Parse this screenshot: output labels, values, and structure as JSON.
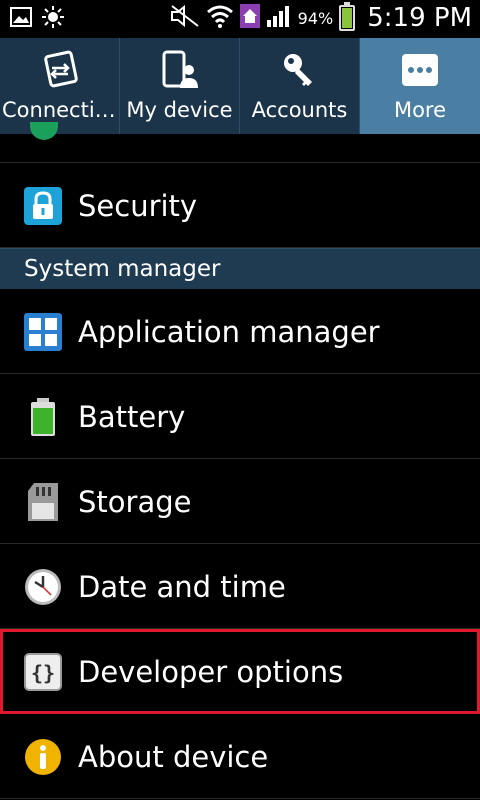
{
  "status_bar": {
    "battery_percent": "94%",
    "time": "5:19 PM",
    "icons": [
      "image-icon",
      "brightness-icon",
      "mute-icon",
      "wifi-icon",
      "home-icon",
      "signal-icon",
      "battery-icon"
    ]
  },
  "tabs": [
    {
      "label": "Connectio..",
      "icon": "connections-icon",
      "active": false
    },
    {
      "label": "My device",
      "icon": "my-device-icon",
      "active": false
    },
    {
      "label": "Accounts",
      "icon": "key-icon",
      "active": false
    },
    {
      "label": "More",
      "icon": "more-icon",
      "active": true
    }
  ],
  "list": {
    "security": {
      "label": "Security",
      "icon": "lock-icon"
    },
    "section_header": "System manager",
    "items": [
      {
        "label": "Application manager",
        "icon": "apps-grid-icon"
      },
      {
        "label": "Battery",
        "icon": "battery-icon"
      },
      {
        "label": "Storage",
        "icon": "sd-card-icon"
      },
      {
        "label": "Date and time",
        "icon": "clock-icon"
      },
      {
        "label": "Developer options",
        "icon": "braces-icon",
        "highlighted": true
      },
      {
        "label": "About device",
        "icon": "info-icon"
      }
    ]
  },
  "colors": {
    "tab_bar_bg": "#1b3449",
    "tab_active_bg": "#4a7ea3",
    "section_header_bg": "#1e3b52",
    "highlight": "#e0182d"
  }
}
